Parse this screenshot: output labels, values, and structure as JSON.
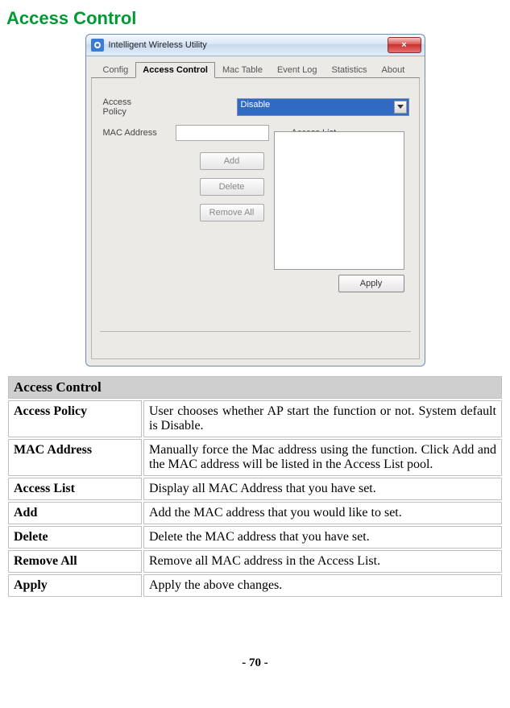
{
  "headings": {
    "page_title": "Access Control",
    "table_title": "Access Control"
  },
  "dialog": {
    "window_title": "Intelligent Wireless Utility",
    "close_label": "×",
    "tabs": [
      "Config",
      "Access Control",
      "Mac Table",
      "Event Log",
      "Statistics",
      "About"
    ],
    "active_tab_index": 1,
    "labels": {
      "access_policy": "Access Policy",
      "mac_address": "MAC Address",
      "access_list": "Access List"
    },
    "access_policy_value": "Disable",
    "buttons": {
      "add": "Add",
      "delete": "Delete",
      "remove_all": "Remove All",
      "apply": "Apply"
    }
  },
  "table_rows": [
    {
      "key": "Access Policy",
      "value": "User chooses whether AP start the function or not. System default is Disable."
    },
    {
      "key": "MAC Address",
      "value": "Manually force the Mac address using the function. Click Add and the MAC address will be listed in the Access List pool."
    },
    {
      "key": "Access List",
      "value": "Display all MAC Address that you have set."
    },
    {
      "key": "Add",
      "value": "Add the MAC address that you would like to set."
    },
    {
      "key": "Delete",
      "value": "Delete the MAC address that you have set."
    },
    {
      "key": "Remove All",
      "value": "Remove all MAC address in the Access List."
    },
    {
      "key": "Apply",
      "value": "Apply the above changes."
    }
  ],
  "page_number": "- 70 -"
}
